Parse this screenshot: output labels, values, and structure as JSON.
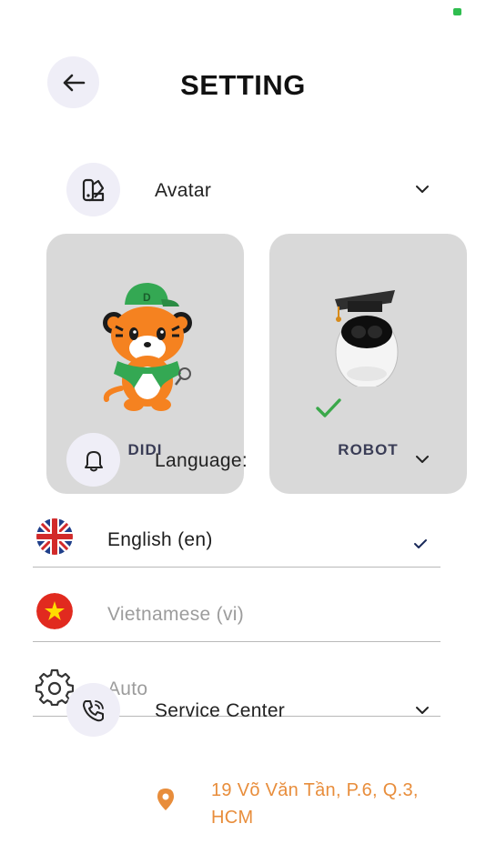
{
  "header": {
    "title": "SETTING",
    "back_icon": "arrow-left-icon"
  },
  "avatar_section": {
    "label": "Avatar",
    "icon": "palette-icon",
    "cards": [
      {
        "name": "DIDI",
        "image": "tiger-mascot",
        "selected": false
      },
      {
        "name": "ROBOT",
        "image": "robot-mascot",
        "selected": true
      }
    ]
  },
  "language_section": {
    "label": "Language:",
    "icon": "bell-icon",
    "options": [
      {
        "label": "English (en)",
        "flag": "uk-flag-icon",
        "selected": true
      },
      {
        "label": "Vietnamese (vi)",
        "flag": "vietnam-flag-icon",
        "selected": false
      },
      {
        "label": "Auto",
        "flag": "gear-icon",
        "selected": false
      }
    ]
  },
  "service_section": {
    "label": "Service Center",
    "icon": "phone-icon",
    "address": "19 Võ Văn Tần, P.6, Q.3, HCM"
  },
  "colors": {
    "accent": "#e88d3b",
    "check_green": "#3aa84a",
    "card_bg": "#d9d9d9",
    "circle_bg": "#efeef7"
  }
}
